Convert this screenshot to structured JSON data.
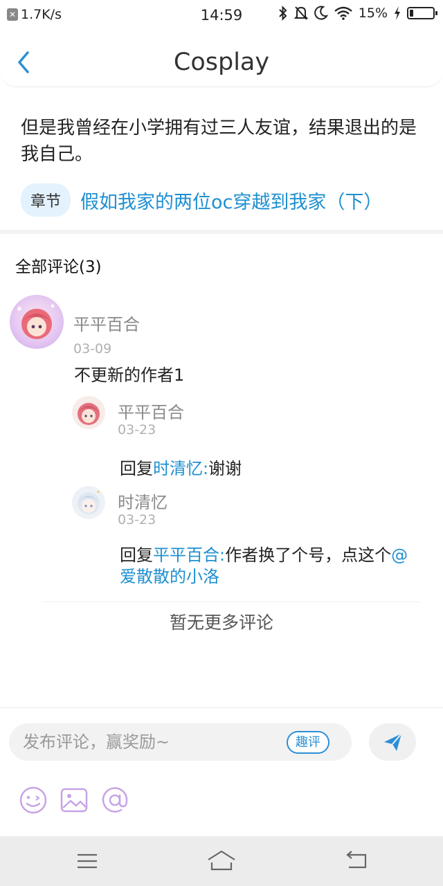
{
  "status_bar": {
    "speed": "1.7K/s",
    "time": "14:59",
    "battery_pct": "15%",
    "battery_level": 0.15
  },
  "header": {
    "title": "Cosplay",
    "back_icon": "chevron-left-icon"
  },
  "intro": {
    "text": "但是我曾经在小学拥有过三人友谊，结果退出的是我自己。",
    "chapter_tag": "章节",
    "chapter_title": "假如我家的两位oc穿越到我家（下）"
  },
  "comments": {
    "title": "全部评论(3)",
    "main": {
      "user": "平平百合",
      "date": "03-09",
      "text": "不更新的作者1"
    },
    "replies": [
      {
        "user": "平平百合",
        "date": "03-23",
        "prefix": "回复",
        "target": "时清忆:",
        "text": "谢谢"
      },
      {
        "user": "时清忆",
        "date": "03-23",
        "prefix": "回复",
        "target": "平平百合:",
        "text": "作者换了个号，点这个",
        "mention_line1": "@",
        "mention_line2": "爱散散的小洛"
      }
    ],
    "no_more": "暂无更多评论"
  },
  "input_bar": {
    "placeholder": "发布评论，赢奖励~",
    "quping_label": "趣评",
    "send_icon": "send-icon",
    "tools": [
      "emoji-icon",
      "image-icon",
      "at-icon"
    ]
  },
  "colors": {
    "accent": "#1e8fd0",
    "tag_bg": "#e3f2fc",
    "tool_purple": "#c7a3e6"
  }
}
